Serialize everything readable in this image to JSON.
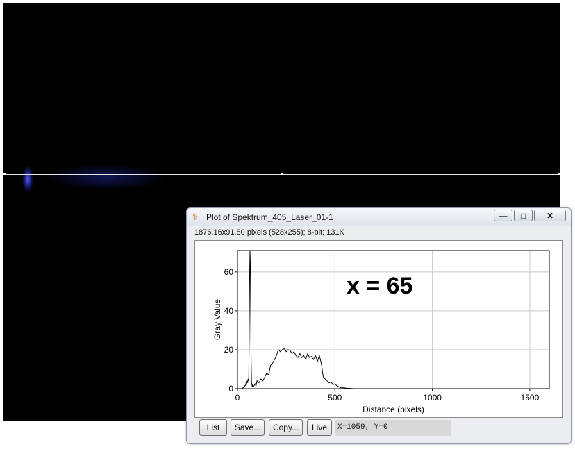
{
  "window": {
    "title": "Plot of Spektrum_405_Laser_01-1",
    "icon": "microscope-icon",
    "minimize_glyph": "—",
    "maximize_glyph": "□",
    "close_glyph": "✕"
  },
  "info_line": "1876.16x91.80 pixels (528x255); 8-bit; 131K",
  "buttons": {
    "list": "List",
    "save": "Save...",
    "copy": "Copy...",
    "live": "Live"
  },
  "coords": "X=1059, Y=0",
  "colors": {
    "canvas_background": "#000000",
    "laser_spot": "#5a64ff",
    "profile_line": "#e8e8e8"
  },
  "chart_data": {
    "type": "line",
    "xlabel": "Distance (pixels)",
    "ylabel": "Gray Value",
    "xlim": [
      0,
      1600
    ],
    "ylim": [
      0,
      71
    ],
    "x_ticks": [
      0,
      500,
      1000,
      1500
    ],
    "y_ticks": [
      0,
      20,
      40,
      60
    ],
    "grid": true,
    "annotation": "x = 65",
    "series": [
      {
        "x": [
          0,
          20,
          30,
          35,
          38,
          40,
          42,
          44,
          46,
          48,
          50,
          52,
          54,
          56,
          58,
          60,
          62,
          64,
          66,
          68,
          70,
          72,
          74,
          76,
          78,
          80,
          85,
          90,
          95,
          100,
          110,
          120,
          130,
          140,
          150,
          160,
          170,
          180,
          190,
          200,
          210,
          220,
          230,
          240,
          250,
          260,
          270,
          280,
          290,
          300,
          310,
          320,
          330,
          340,
          350,
          360,
          370,
          380,
          390,
          400,
          410,
          420,
          430,
          440,
          450,
          460,
          470,
          480,
          490,
          500,
          510,
          520,
          530,
          540,
          560,
          600,
          1600
        ],
        "y": [
          0,
          0,
          0.5,
          1,
          1.5,
          1.5,
          2,
          3,
          4,
          3,
          4,
          3,
          5,
          4,
          6,
          25,
          55,
          71,
          64,
          40,
          15,
          3,
          2,
          1,
          2,
          1,
          1.5,
          2.5,
          1.5,
          4,
          3,
          5,
          4,
          6,
          8,
          7,
          12,
          13,
          15,
          17,
          20,
          19,
          20,
          20.5,
          19,
          20,
          19.5,
          18,
          19,
          17,
          16,
          18,
          16,
          17,
          15,
          18,
          16,
          16.5,
          15,
          17,
          14,
          17,
          13,
          6,
          5,
          4,
          3,
          3.5,
          2,
          2.5,
          1.5,
          1,
          0.5,
          0.5,
          0.2,
          0,
          0
        ]
      }
    ]
  }
}
